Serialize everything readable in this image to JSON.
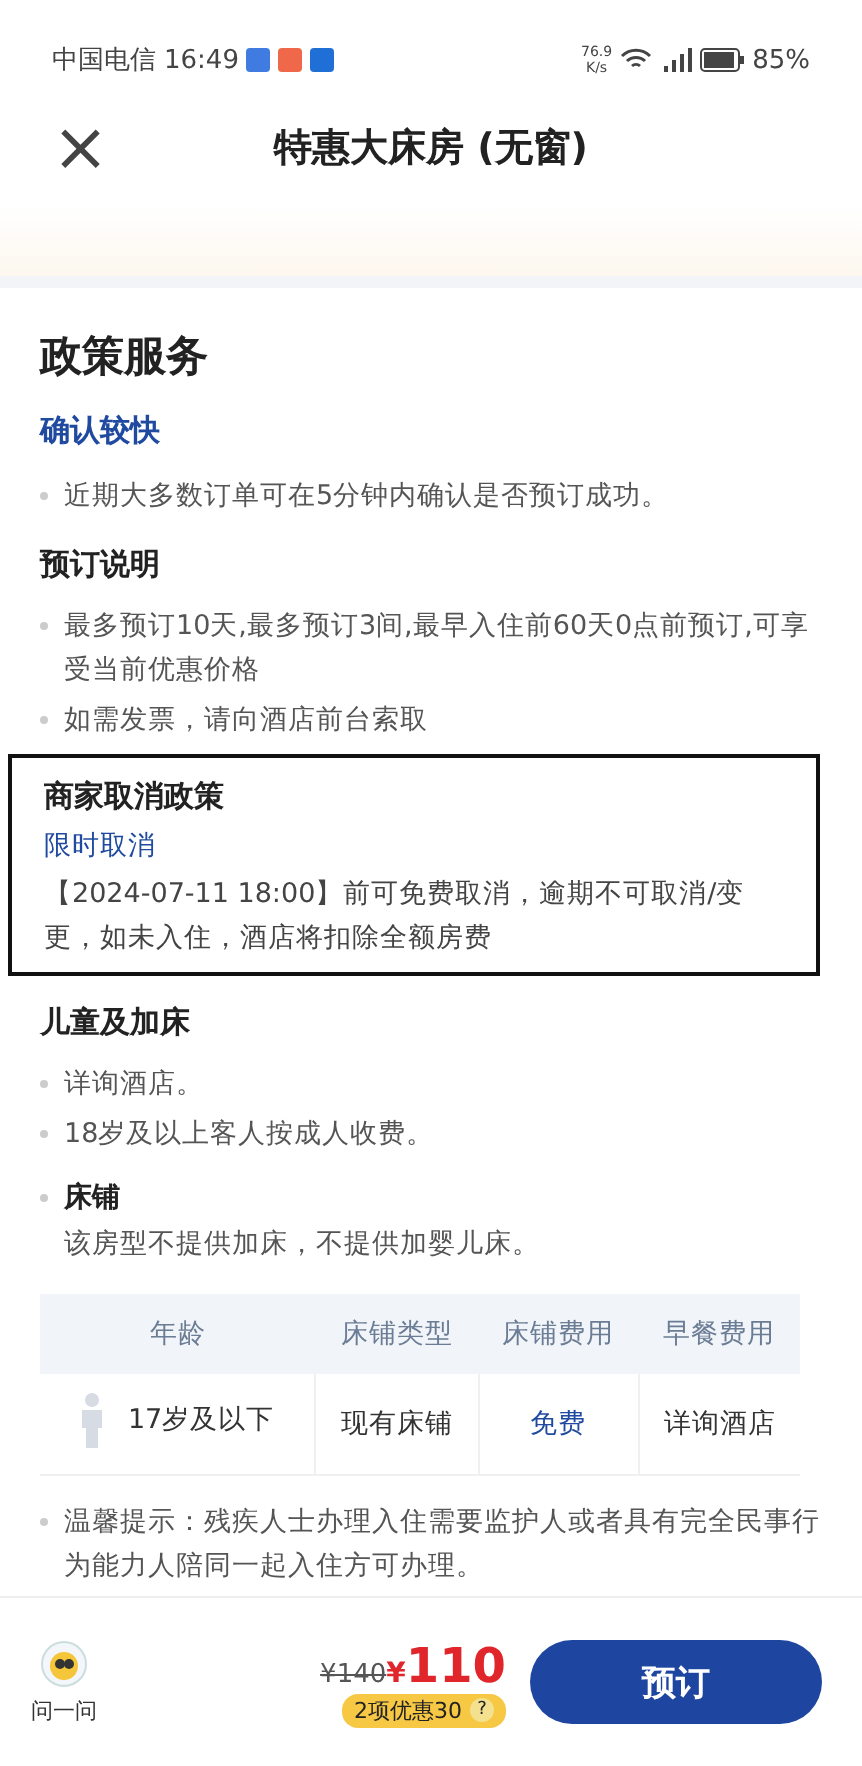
{
  "status_bar": {
    "carrier": "中国电信",
    "time": "16:49",
    "speed": "76.9",
    "speed_unit": "K/s",
    "battery": "85%"
  },
  "header": {
    "close": "×",
    "title": "特惠大床房 (无窗)"
  },
  "section_title": "政策服务",
  "confirm": {
    "title": "确认较快",
    "items": [
      "近期大多数订单可在5分钟内确认是否预订成功。"
    ]
  },
  "booking": {
    "title": "预订说明",
    "items": [
      "最多预订10天,最多预订3间,最早入住前60天0点前预订,可享受当前优惠价格",
      "如需发票，请向酒店前台索取"
    ]
  },
  "cancel": {
    "title": "商家取消政策",
    "tag": "限时取消",
    "text": "【2024-07-11 18:00】前可免费取消，逾期不可取消/变更，如未入住，酒店将扣除全额房费"
  },
  "children": {
    "title": "儿童及加床",
    "items": [
      "详询酒店。",
      "18岁及以上客人按成人收费。"
    ],
    "bed_title": "床铺",
    "bed_text": "该房型不提供加床，不提供加婴儿床。"
  },
  "table": {
    "columns": [
      "年龄",
      "床铺类型",
      "床铺费用",
      "早餐费用"
    ],
    "rows": [
      [
        "17岁及以下",
        "现有床铺",
        "免费",
        "详询酒店"
      ]
    ]
  },
  "tip": "温馨提示：残疾人士办理入住需要监护人或者具有完全民事行为能力人陪同一起入住方可办理。",
  "bottom_bar": {
    "ask": "问一问",
    "old_price": "¥140",
    "currency": "¥",
    "price": "110",
    "discount": "2项优惠30",
    "help": "?",
    "book": "预订"
  }
}
